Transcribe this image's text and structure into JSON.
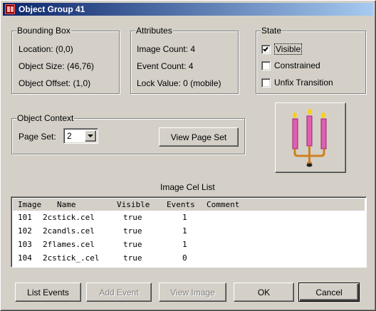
{
  "window": {
    "title": "Object Group 41"
  },
  "bounding_box": {
    "legend": "Bounding Box",
    "location": "Location:  (0,0)",
    "object_size": "Object Size:  (46,76)",
    "object_offset": "Object Offset:  (1,0)"
  },
  "attributes": {
    "legend": "Attributes",
    "image_count": "Image Count:  4",
    "event_count": "Event Count:  4",
    "lock_value": "Lock Value:  0  (mobile)"
  },
  "state": {
    "legend": "State",
    "visible": {
      "label": "Visible",
      "checked": true
    },
    "constrained": {
      "label": "Constrained",
      "checked": false
    },
    "unfix_transition": {
      "label": "Unfix Transition",
      "checked": false
    }
  },
  "object_context": {
    "legend": "Object Context",
    "page_set_label": "Page Set:",
    "page_set_value": "2",
    "view_page_set_button": "View Page Set"
  },
  "preview": {
    "icon": "candelabra-icon",
    "candle_color": "#e060b0",
    "flame_color": "#ffd000",
    "holder_color": "#d08020"
  },
  "image_cel_list": {
    "title": "Image Cel List",
    "columns": [
      "Image",
      "Name",
      "Visible",
      "Events",
      "Comment"
    ],
    "rows": [
      [
        "101",
        "2cstick.cel",
        "true",
        "1",
        ""
      ],
      [
        "102",
        "2candls.cel",
        "true",
        "1",
        ""
      ],
      [
        "103",
        "2flames.cel",
        "true",
        "1",
        ""
      ],
      [
        "104",
        "2cstick_.cel",
        "true",
        "0",
        ""
      ]
    ]
  },
  "buttons": {
    "list_events": "List Events",
    "add_event": "Add Event",
    "view_image": "View Image",
    "ok": "OK",
    "cancel": "Cancel"
  }
}
